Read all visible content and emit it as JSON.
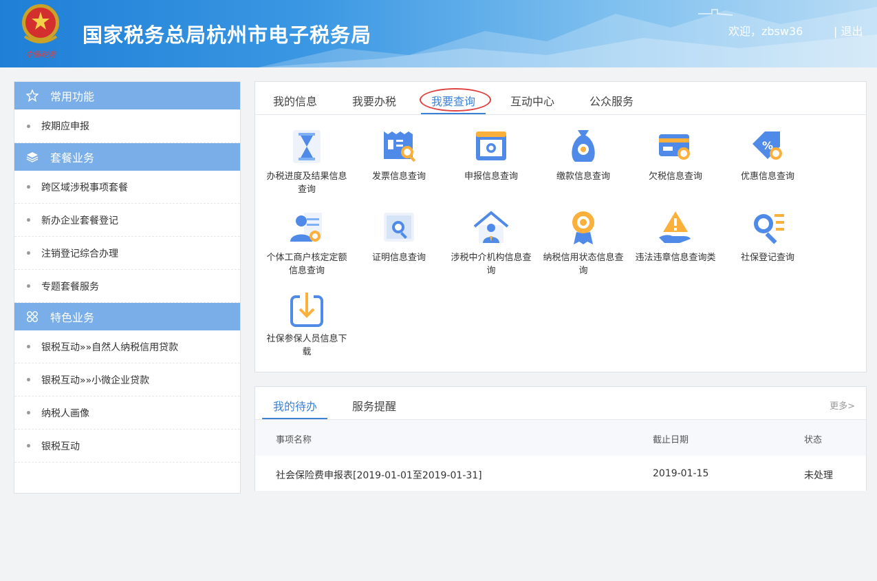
{
  "header": {
    "title": "国家税务总局杭州市电子税务局",
    "welcome": "欢迎，zbsw36",
    "logout": "| 退出",
    "emblem_text": "中国税务"
  },
  "sidebar": {
    "sections": [
      {
        "title": "常用功能",
        "icon": "star-icon",
        "items": [
          "按期应申报"
        ]
      },
      {
        "title": "套餐业务",
        "icon": "layers-icon",
        "items": [
          "跨区域涉税事项套餐",
          "新办企业套餐登记",
          "注销登记综合办理",
          "专题套餐服务"
        ]
      },
      {
        "title": "特色业务",
        "icon": "grid-icon",
        "items": [
          "银税互动»»自然人纳税信用贷款",
          "银税互动»»小微企业贷款",
          "纳税人画像",
          "银税互动"
        ]
      }
    ]
  },
  "query_panel": {
    "tabs": [
      "我的信息",
      "我要办税",
      "我要查询",
      "互动中心",
      "公众服务"
    ],
    "active_tab": "我要查询",
    "tiles": [
      {
        "label": "办税进度及结果信息查询",
        "icon": "hourglass-icon"
      },
      {
        "label": "发票信息查询",
        "icon": "invoice-search-icon"
      },
      {
        "label": "申报信息查询",
        "icon": "declaration-search-icon"
      },
      {
        "label": "缴款信息查询",
        "icon": "moneybag-search-icon"
      },
      {
        "label": "欠税信息查询",
        "icon": "card-search-icon"
      },
      {
        "label": "优惠信息查询",
        "icon": "discount-tag-icon"
      },
      {
        "label": "个体工商户核定定额信息查询",
        "icon": "person-doc-icon"
      },
      {
        "label": "证明信息查询",
        "icon": "certificate-search-icon"
      },
      {
        "label": "涉税中介机构信息查询",
        "icon": "house-person-icon"
      },
      {
        "label": "纳税信用状态信息查询",
        "icon": "medal-icon"
      },
      {
        "label": "违法违章信息查询类",
        "icon": "warning-hand-icon"
      },
      {
        "label": "社保登记查询",
        "icon": "search-list-icon"
      },
      {
        "label": "社保参保人员信息下载",
        "icon": "download-icon"
      }
    ]
  },
  "todo_panel": {
    "tabs": [
      "我的待办",
      "服务提醒"
    ],
    "active_tab": "我的待办",
    "more": "更多>",
    "columns": [
      "事项名称",
      "截止日期",
      "状态"
    ],
    "rows": [
      {
        "name": "社会保险费申报表[2019-01-01至2019-01-31]",
        "date": "2019-01-15",
        "status": "未处理"
      }
    ]
  },
  "colors": {
    "accent": "#3b82d6",
    "sidebar_header": "#7aaee9",
    "highlight_ring": "#e04040"
  }
}
